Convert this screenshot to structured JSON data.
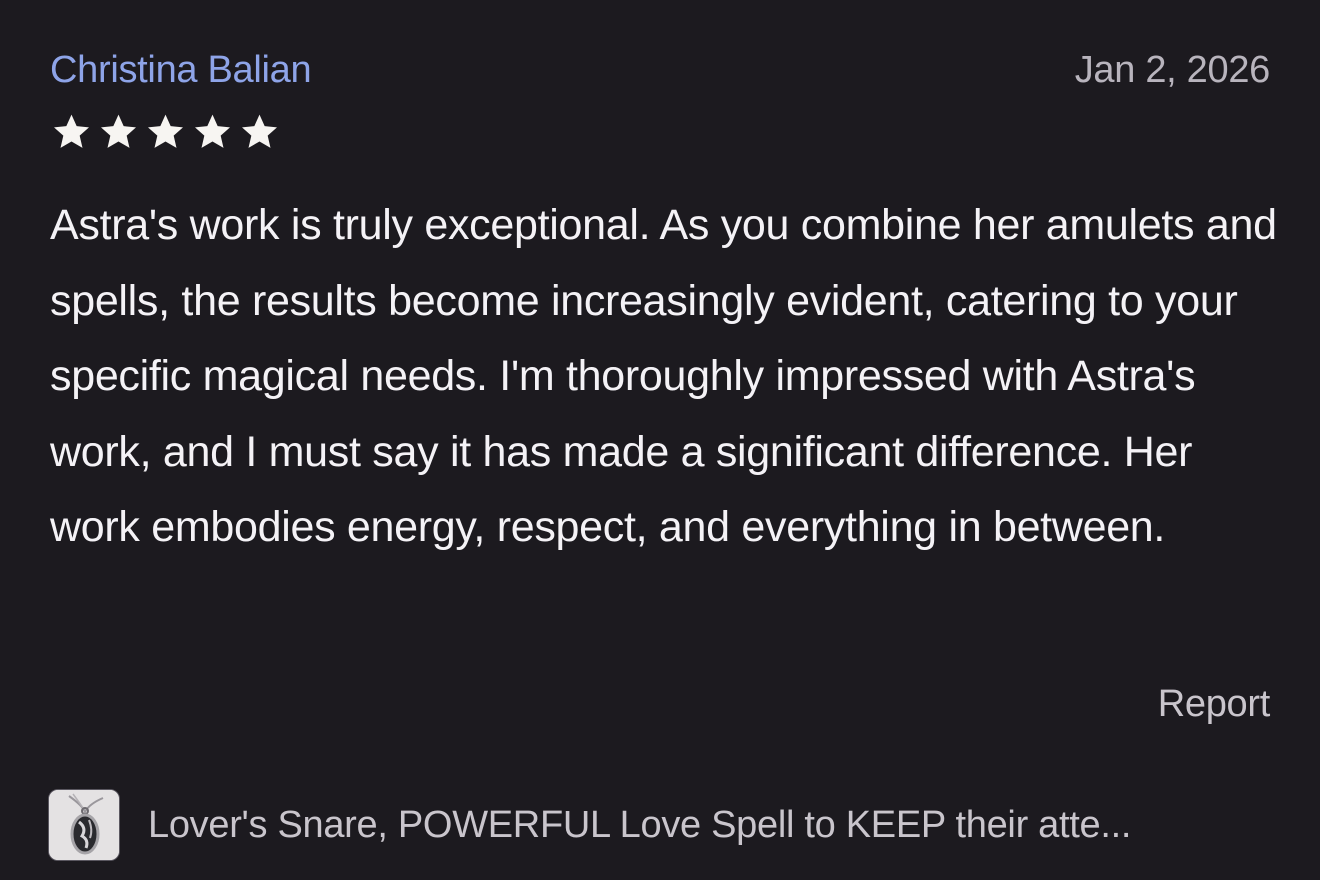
{
  "review": {
    "reviewer_name": "Christina Balian",
    "date": "Jan 2, 2026",
    "rating": 5,
    "rating_max": 5,
    "body": "Astra's work is truly exceptional. As you combine her amulets and spells, the results become increasingly evident, catering to your specific magical needs. I'm thoroughly impressed with Astra's work, and I must say it has made a significant difference. Her work embodies energy, respect, and everything in between.",
    "report_label": "Report"
  },
  "product": {
    "title": "Lover's Snare, POWERFUL Love Spell to KEEP their atte...",
    "thumbnail_icon": "amulet-pendant-thumbnail"
  },
  "colors": {
    "background": "#1c1a1f",
    "name_link": "#8ea4e8",
    "body_text": "#f4f2f6",
    "muted_text": "#c9c5cc",
    "star": "#f7f5f2"
  }
}
